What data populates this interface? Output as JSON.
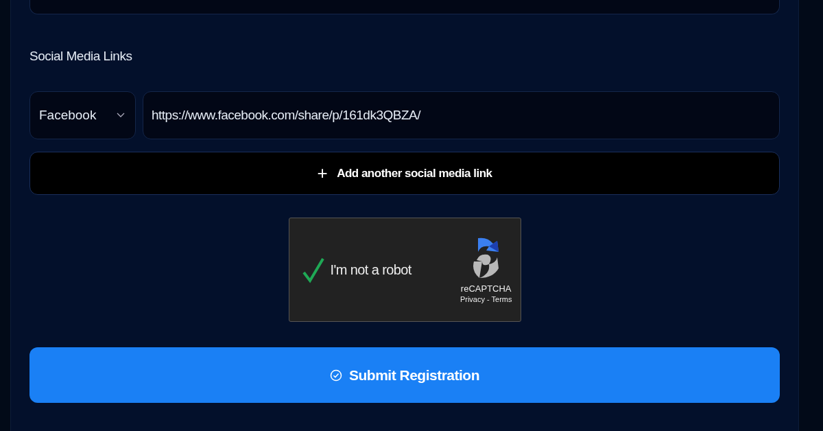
{
  "section_title": "Social Media Links",
  "social_links": [
    {
      "platform": "Facebook",
      "url": "https://www.facebook.com/share/p/161dk3QBZA/"
    }
  ],
  "add_link_button": {
    "icon": "+",
    "label": "Add another social media link"
  },
  "captcha": {
    "label": "I'm not a robot",
    "checked": true,
    "brand": "reCAPTCHA",
    "links": "Privacy - Terms"
  },
  "submit_button": {
    "label": "Submit Registration"
  }
}
